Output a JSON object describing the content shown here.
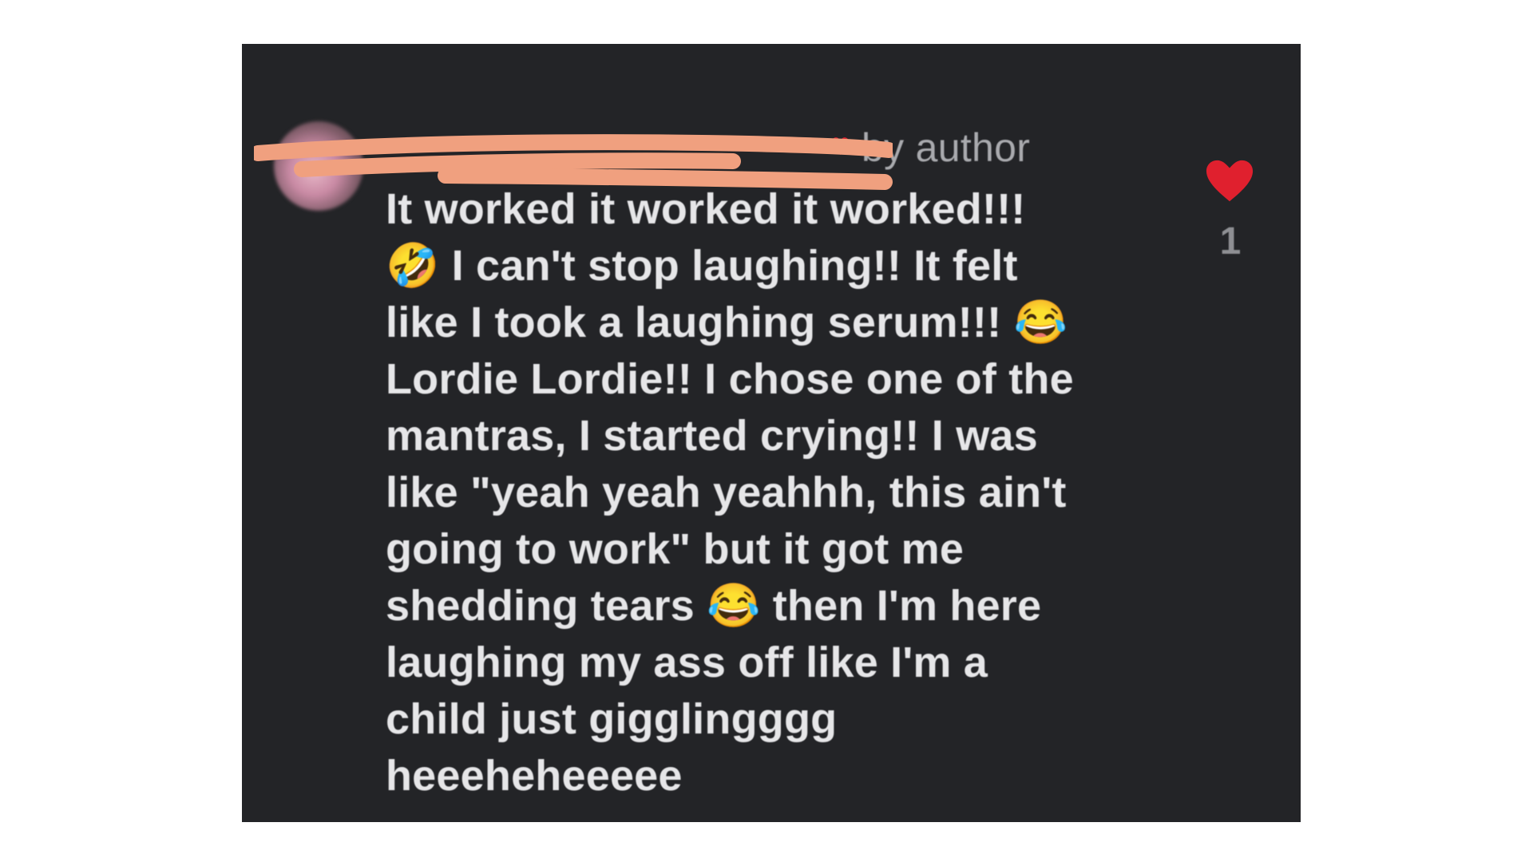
{
  "comment": {
    "username": "",
    "author_tag": "by author",
    "text": "It worked it worked it worked!!!\n🤣 I can't stop laughing!! It felt\nlike I took a laughing serum!!! 😂\nLordie Lordie!! I chose one of the\nmantras, I started crying!! I was\nlike \"yeah yeah yeahhh, this ain't\ngoing to work\" but it got me\nshedding tears 😂 then I'm here\nlaughing my ass off like I'm a\nchild just gigglingggg\nheeeheheeeee",
    "like_count": "1",
    "like_icon": "heart-icon",
    "liked_by_author_icon": "heart-icon"
  },
  "colors": {
    "panel_bg": "#232427",
    "text": "#e6e6e8",
    "muted": "#a9aaae",
    "heart": "#e0202e",
    "redaction": "#f0a07f"
  }
}
